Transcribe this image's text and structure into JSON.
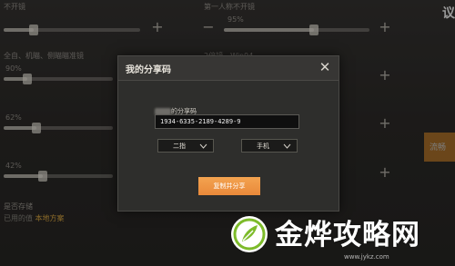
{
  "background": {
    "top_left_label": "不开镜",
    "top_right_label": "第一人称不开镜",
    "top_right_value": "95%",
    "row2_left_label": "全自、机瞄、侧瞄瞄准镜",
    "row2_right_label": "2倍镜、Win94",
    "row2_left_value": "90%",
    "row3_value": "62%",
    "row4_value": "42%",
    "sliders": [
      0.22,
      0.62,
      0.22,
      0.3,
      0.36,
      0.3
    ],
    "side_button_label": "流畅",
    "corner_text": "议",
    "bottom_left_line1": "是否存储",
    "bottom_left_line2_prefix": "已用的值 ",
    "bottom_left_line2_highlight": "本地方案"
  },
  "modal": {
    "title": "我的分享码",
    "code_label": "的分享码",
    "share_code": "1934-6335-2189-4289-9",
    "dropdown_scope": "二指",
    "dropdown_device": "手机",
    "copy_button": "复制并分享"
  },
  "watermark": {
    "text": "金烨攻略网",
    "url": "www.jykz.com"
  },
  "colors": {
    "accent": "#e9893a",
    "watermark_green": "#7dbb2a"
  }
}
